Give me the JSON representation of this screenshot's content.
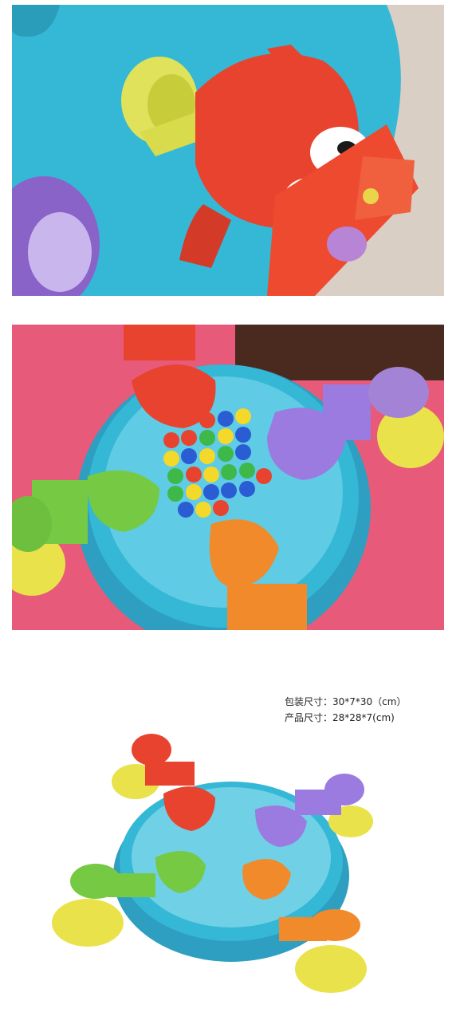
{
  "specs": {
    "package_size": "包装尺寸：30*7*30（cm）",
    "product_size": "产品尺寸：28*28*7(cm)"
  },
  "colors": {
    "board": "#35b7d6",
    "red_frog": "#e8432e",
    "purple_frog": "#9b7be0",
    "green_frog": "#76c942",
    "orange_frog": "#f08a2a",
    "tray": "#e9e24a",
    "cloth": "#e85a7a"
  }
}
